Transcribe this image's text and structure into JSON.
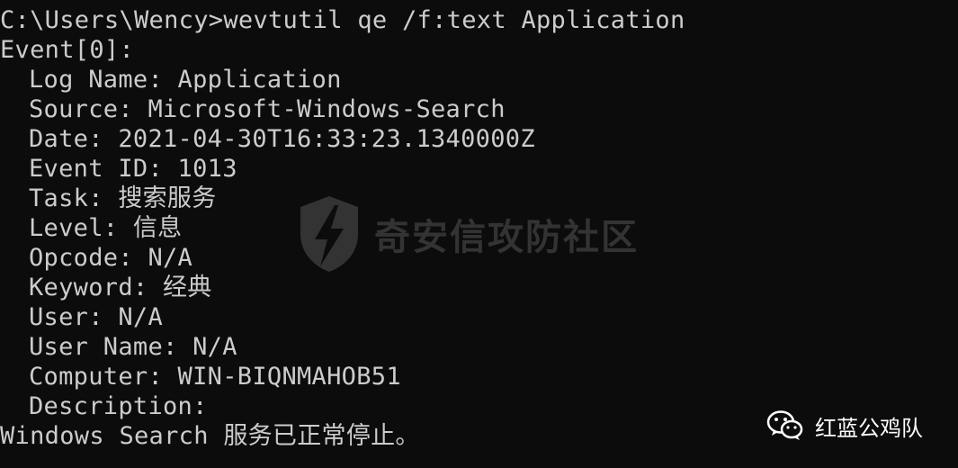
{
  "console": {
    "lines": [
      {
        "text": "C:\\Users\\Wency>wevtutil qe /f:text Application",
        "indent": false
      },
      {
        "text": "Event[0]:",
        "indent": false
      },
      {
        "text": "Log Name: Application",
        "indent": true
      },
      {
        "text": "Source: Microsoft-Windows-Search",
        "indent": true
      },
      {
        "text": "Date: 2021-04-30T16:33:23.1340000Z",
        "indent": true
      },
      {
        "text": "Event ID: 1013",
        "indent": true
      },
      {
        "text": "Task: 搜索服务",
        "indent": true
      },
      {
        "text": "Level: 信息",
        "indent": true
      },
      {
        "text": "Opcode: N/A",
        "indent": true
      },
      {
        "text": "Keyword: 经典",
        "indent": true
      },
      {
        "text": "User: N/A",
        "indent": true
      },
      {
        "text": "User Name: N/A",
        "indent": true
      },
      {
        "text": "Computer: WIN-BIQNMAHOB51",
        "indent": true
      },
      {
        "text": "Description:",
        "indent": true
      },
      {
        "text": "Windows Search 服务已正常停止。",
        "indent": false
      }
    ]
  },
  "watermark": {
    "text": "奇安信攻防社区",
    "icon": "shield-lightning-icon"
  },
  "brand": {
    "text": "红蓝公鸡队",
    "icon": "wechat-icon"
  },
  "colors": {
    "background": "#0c0c0c",
    "text": "#cccccc"
  }
}
